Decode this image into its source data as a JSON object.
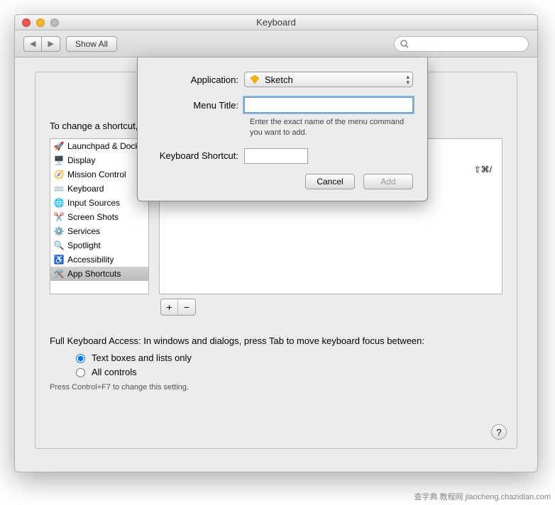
{
  "window": {
    "title": "Keyboard"
  },
  "toolbar": {
    "back_label": "◀",
    "fwd_label": "▶",
    "showall_label": "Show All",
    "search_placeholder": ""
  },
  "pane": {
    "instruction": "To change a shortcut, select it, click the key combination, and then type the new keys.",
    "sidebar": [
      {
        "icon": "launchpad-icon",
        "label": "Launchpad & Dock"
      },
      {
        "icon": "display-icon",
        "label": "Display"
      },
      {
        "icon": "mission-control-icon",
        "label": "Mission Control"
      },
      {
        "icon": "keyboard-icon",
        "label": "Keyboard"
      },
      {
        "icon": "input-sources-icon",
        "label": "Input Sources"
      },
      {
        "icon": "screenshots-icon",
        "label": "Screen Shots"
      },
      {
        "icon": "services-icon",
        "label": "Services"
      },
      {
        "icon": "spotlight-icon",
        "label": "Spotlight"
      },
      {
        "icon": "accessibility-icon",
        "label": "Accessibility"
      },
      {
        "icon": "app-shortcuts-icon",
        "label": "App Shortcuts"
      }
    ],
    "selected_index": 9,
    "shortcut_sample": "⇧⌘/",
    "add_label": "+",
    "remove_label": "−",
    "fka_label": "Full Keyboard Access: In windows and dialogs, press Tab to move keyboard focus between:",
    "radio1": "Text boxes and lists only",
    "radio2": "All controls",
    "hint": "Press Control+F7 to change this setting.",
    "help_label": "?"
  },
  "sheet": {
    "application_label": "Application:",
    "application_value": "Sketch",
    "menutitle_label": "Menu Title:",
    "menutitle_value": "",
    "menutitle_help": "Enter the exact name of the menu command you want to add.",
    "shortcut_label": "Keyboard Shortcut:",
    "shortcut_value": "",
    "cancel_label": "Cancel",
    "add_label": "Add"
  },
  "watermark": "查字典 教程网  jiaocheng.chazidian.com"
}
